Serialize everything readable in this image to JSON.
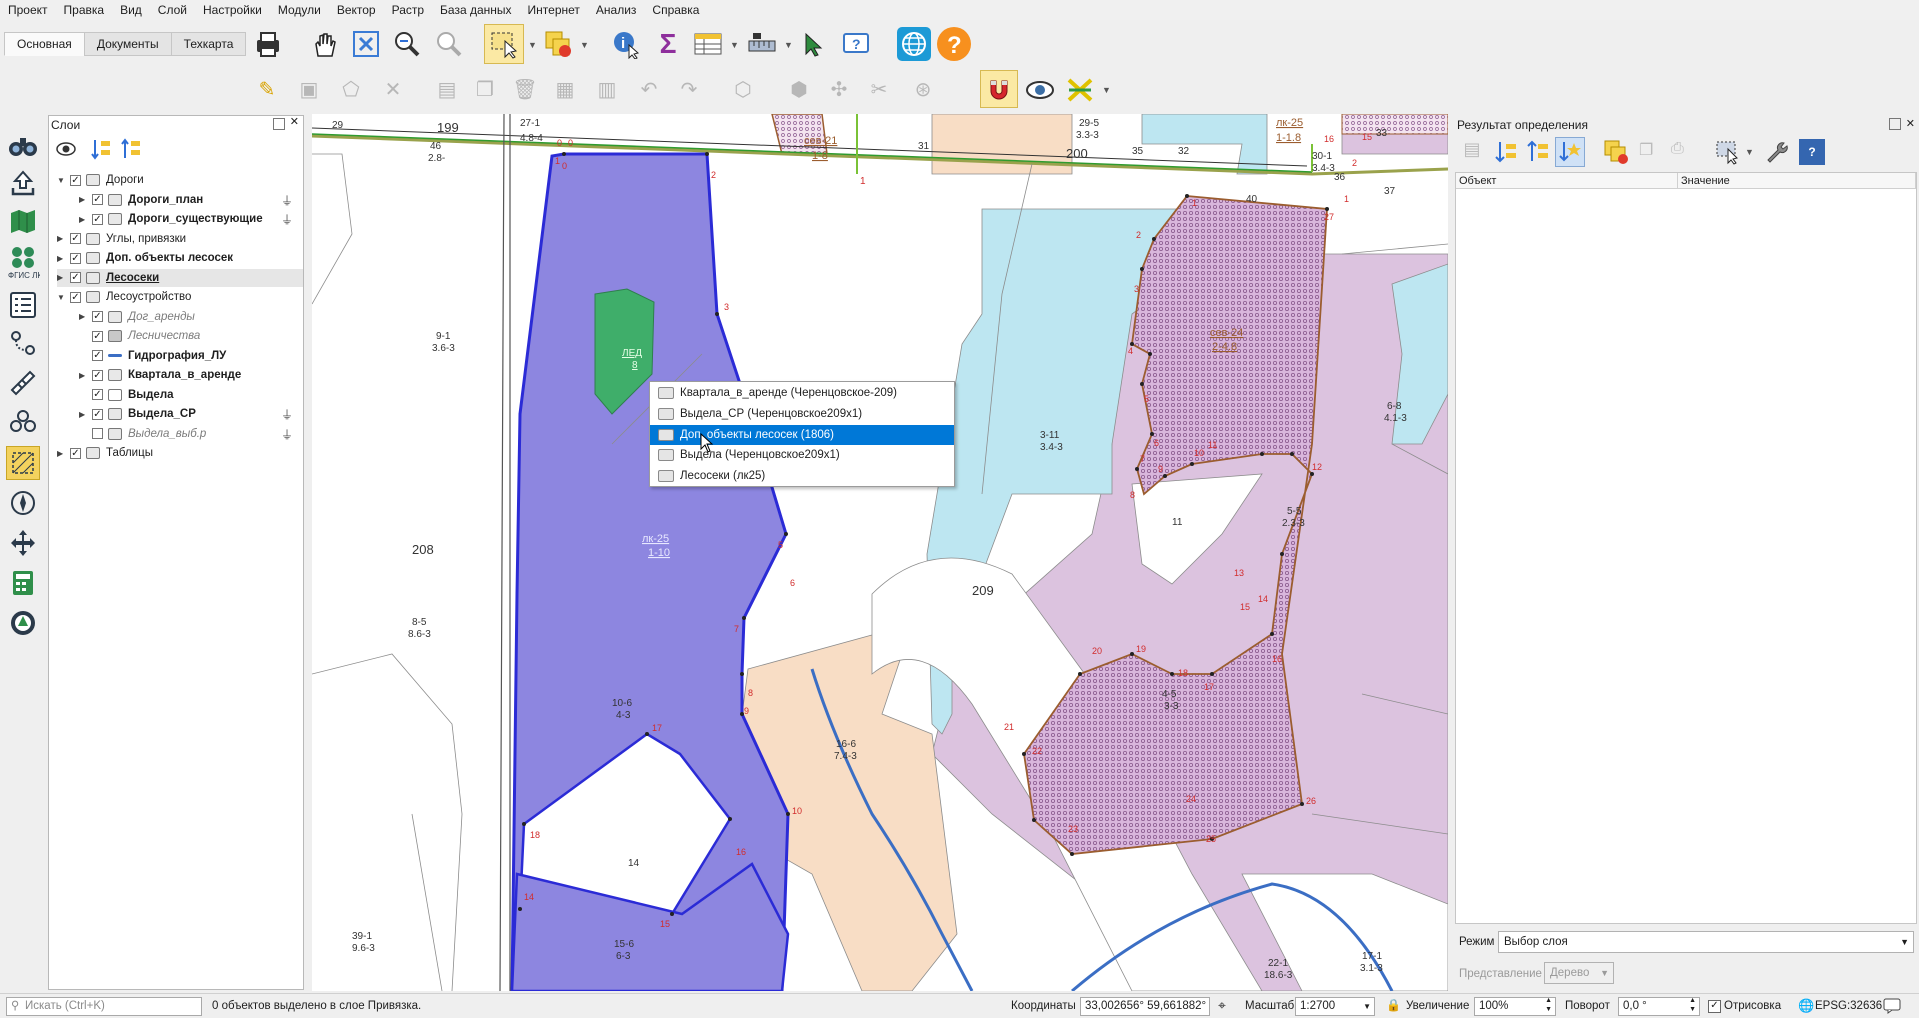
{
  "menu": [
    "Проект",
    "Правка",
    "Вид",
    "Слой",
    "Настройки",
    "Модули",
    "Вектор",
    "Растр",
    "База данных",
    "Интернет",
    "Анализ",
    "Справка"
  ],
  "tabs": [
    "Основная",
    "Документы",
    "Техкарта"
  ],
  "panels": {
    "layers_title": "Слои",
    "results_title": "Результат определения"
  },
  "layers": [
    {
      "label": "Дороги",
      "style": "normal",
      "indent": 0,
      "expand": "▼",
      "checked": true
    },
    {
      "label": "Дороги_план",
      "style": "bold",
      "indent": 1,
      "expand": "▶",
      "checked": true,
      "filter": true
    },
    {
      "label": "Дороги_существующие",
      "style": "bold",
      "indent": 1,
      "expand": "▶",
      "checked": true,
      "filter": true
    },
    {
      "label": "Углы, привязки",
      "style": "normal",
      "indent": 0,
      "expand": "▶",
      "checked": true
    },
    {
      "label": "Доп. объекты лесосек",
      "style": "bold",
      "indent": 0,
      "expand": "▶",
      "checked": true
    },
    {
      "label": "Лесосеки",
      "style": "bold-underline",
      "indent": 0,
      "expand": "▶",
      "checked": true
    },
    {
      "label": "Лесоустройство",
      "style": "normal",
      "indent": 0,
      "expand": "▼",
      "checked": true
    },
    {
      "label": "Дог_аренды",
      "style": "italic",
      "indent": 1,
      "expand": "▶",
      "checked": true
    },
    {
      "label": "Лесничества",
      "style": "italic",
      "indent": 1,
      "expand": "",
      "checked": true
    },
    {
      "label": "Гидрография_ЛУ",
      "style": "bold",
      "indent": 1,
      "expand": "",
      "checked": true
    },
    {
      "label": "Квартала_в_аренде",
      "style": "bold",
      "indent": 1,
      "expand": "▶",
      "checked": true
    },
    {
      "label": "Выдела",
      "style": "bold",
      "indent": 1,
      "expand": "",
      "checked": true
    },
    {
      "label": "Выдела_СР",
      "style": "bold",
      "indent": 1,
      "expand": "▶",
      "checked": true,
      "filter": true
    },
    {
      "label": "Выдела_выб.р",
      "style": "italic",
      "indent": 1,
      "expand": "",
      "checked": false,
      "filter": true
    },
    {
      "label": "Таблицы",
      "style": "normal",
      "indent": 0,
      "expand": "▶",
      "checked": true
    }
  ],
  "context_menu": {
    "items": [
      "Квартала_в_аренде (Черенцовское-209)",
      "Выдела_СР (Черенцовское209x1)",
      "Доп. объекты лесосек (1806)",
      "Выдела (Черенцовское209x1)",
      "Лесосеки (лк25)"
    ],
    "selected_index": 2
  },
  "results": {
    "col_object": "Объект",
    "col_value": "Значение",
    "mode_label": "Режим",
    "mode_value": "Выбор слоя",
    "view_label": "Представление",
    "view_value": "Дерево"
  },
  "status": {
    "search_placeholder": "Искать (Ctrl+K)",
    "message": "0 объектов выделено в слое Привязка.",
    "coords_label": "Координаты",
    "coords_value": "33,002656° 59,661882°",
    "scale_label": "Масштаб",
    "scale_value": "1:2700",
    "zoom_label": "Увеличение",
    "zoom_value": "100%",
    "rotation_label": "Поворот",
    "rotation_value": "0,0 °",
    "render_label": "Отрисовка",
    "render_checked": true,
    "crs": "EPSG:32636"
  },
  "map_labels": {
    "parcels": [
      "29",
      "199",
      "27-1",
      "4.8-4",
      "46",
      "2.8-",
      "31",
      "1",
      "200",
      "29-5",
      "3.3-3",
      "35",
      "32",
      "30-1",
      "3.4-3",
      "37",
      "36",
      "33",
      "40",
      "9-1",
      "3.6-3",
      "208",
      "8-5",
      "8.6-3",
      "3-11",
      "3.4-3",
      "11",
      "209",
      "6-8",
      "4.1-3",
      "5-5",
      "2.3-3",
      "10-6",
      "4-3",
      "16-6",
      "7.4-3",
      "14",
      "15-6",
      "6-3",
      "39-1",
      "9.6-3",
      "4-5",
      "3-3",
      "22-1",
      "18.6-3",
      "17-1",
      "3.1-3"
    ],
    "cutting_areas": [
      {
        "name": "лк-25",
        "code": "1-10"
      },
      {
        "name": "сев-21",
        "code": "1-8"
      },
      {
        "name": "лк-25",
        "code": "1-1.8"
      },
      {
        "name": "сев-24",
        "code": "2-4.8"
      }
    ],
    "green_label": [
      "ЛЕД",
      "8"
    ],
    "vertex_numbers": [
      "0",
      "0",
      "0",
      "1",
      "2",
      "3",
      "5",
      "6",
      "7",
      "8",
      "9",
      "10",
      "14",
      "15",
      "16",
      "17",
      "18",
      "1",
      "2",
      "3",
      "4",
      "5",
      "6",
      "7",
      "8",
      "9",
      "10",
      "11",
      "12",
      "13",
      "14",
      "15",
      "16",
      "17",
      "18",
      "19",
      "20",
      "21",
      "22",
      "23",
      "24",
      "25",
      "26",
      "27",
      "1",
      "2",
      "15",
      "16"
    ]
  }
}
